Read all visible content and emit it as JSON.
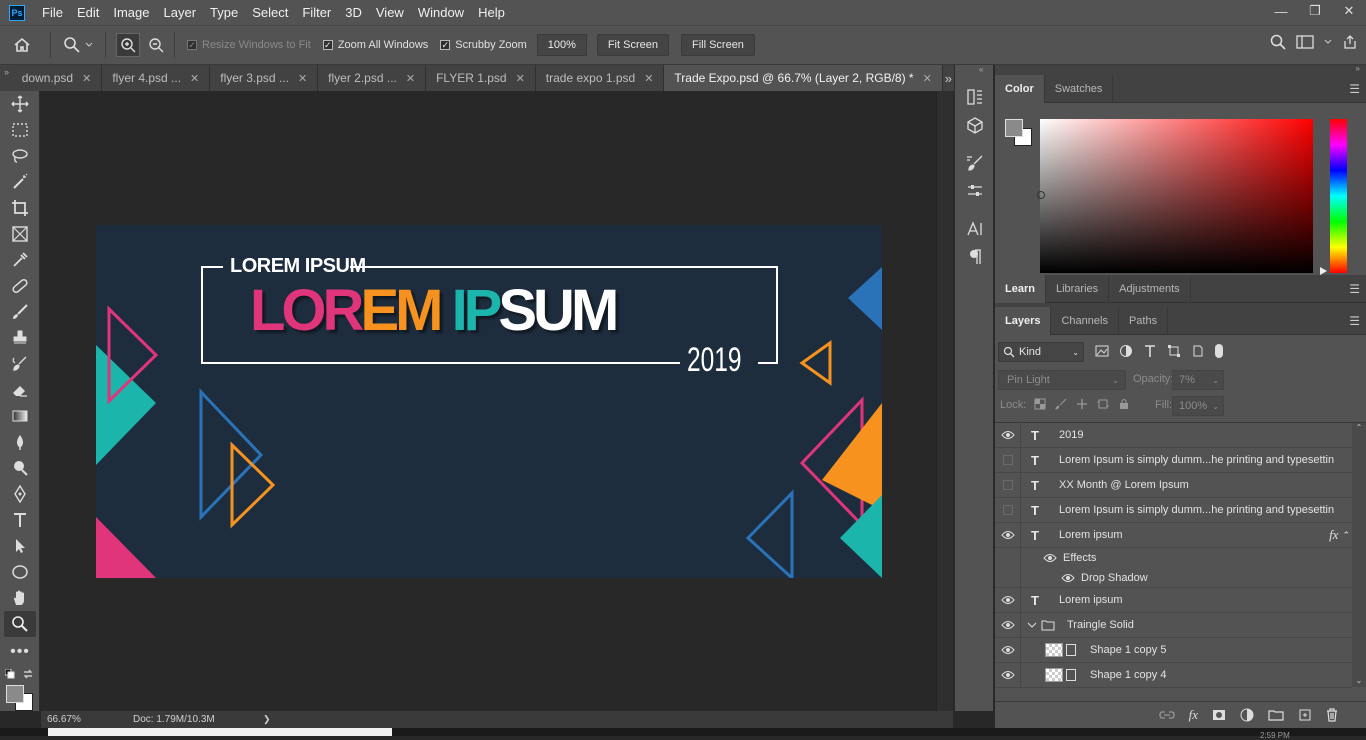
{
  "app": {
    "logo": "Ps"
  },
  "menu": [
    "File",
    "Edit",
    "Image",
    "Layer",
    "Type",
    "Select",
    "Filter",
    "3D",
    "View",
    "Window",
    "Help"
  ],
  "window_controls": {
    "minimize": "—",
    "restore": "❐",
    "close": "✕"
  },
  "options": {
    "resize_windows": "Resize Windows to Fit",
    "zoom_all": "Zoom All Windows",
    "scrubby": "Scrubby Zoom",
    "zoom_value": "100%",
    "fit_screen": "Fit Screen",
    "fill_screen": "Fill Screen"
  },
  "tabs": [
    {
      "label": "down.psd"
    },
    {
      "label": "flyer 4.psd ..."
    },
    {
      "label": "flyer 3.psd ..."
    },
    {
      "label": "flyer 2.psd ..."
    },
    {
      "label": "FLYER 1.psd"
    },
    {
      "label": "trade expo 1.psd"
    },
    {
      "label": "Trade Expo.psd @ 66.7% (Layer 2, RGB/8) *"
    }
  ],
  "tab_close": "✕",
  "tab_overflow": "»",
  "artwork": {
    "top_label": "LOREM IPSUM",
    "headline": {
      "part1": "LOR",
      "part2": "EM",
      "part3": "IP",
      "part4": "SUM"
    },
    "year": "2019",
    "colors": {
      "bg": "#1e2d3e",
      "pink": "#e0357a",
      "orange": "#f7921e",
      "teal": "#1cb5ac",
      "blue": "#2a73b8"
    }
  },
  "status": {
    "zoom": "66.67%",
    "doc": "Doc: 1.79M/10.3M",
    "arrow": "❯"
  },
  "panel_icons": [
    "history-icon",
    "3d-icon",
    "brush-settings-icon",
    "adjust-icon",
    "character-icon",
    "paragraph-icon"
  ],
  "color_panel": {
    "tabs": [
      "Color",
      "Swatches"
    ]
  },
  "learn_panel": {
    "tabs": [
      "Learn",
      "Libraries",
      "Adjustments"
    ]
  },
  "layers_panel": {
    "tabs": [
      "Layers",
      "Channels",
      "Paths"
    ],
    "kind": "Kind",
    "blend": "Pin Light",
    "opacity_label": "Opacity:",
    "opacity": "7%",
    "lock_label": "Lock:",
    "fill_label": "Fill:",
    "fill": "100%",
    "rows": [
      {
        "type": "T",
        "name": "2019",
        "visible": true
      },
      {
        "type": "T",
        "name": "Lorem Ipsum is simply dumm...he printing and typesettin",
        "visible": false
      },
      {
        "type": "T",
        "name": "XX Month @ Lorem Ipsum",
        "visible": false
      },
      {
        "type": "T",
        "name": "Lorem Ipsum is simply dumm...he printing and typesettin",
        "visible": false
      },
      {
        "type": "T",
        "name": "Lorem ipsum",
        "visible": true,
        "fx": "fx"
      },
      {
        "type": "effects",
        "name": "Effects"
      },
      {
        "type": "effect",
        "name": "Drop Shadow"
      },
      {
        "type": "T",
        "name": "Lorem ipsum",
        "visible": true
      },
      {
        "type": "group",
        "name": "Traingle Solid",
        "visible": true
      },
      {
        "type": "shape",
        "name": "Shape 1 copy 5",
        "visible": true
      },
      {
        "type": "shape",
        "name": "Shape 1 copy 4",
        "visible": true
      }
    ]
  },
  "taskbar": {
    "time": "2:59 PM"
  }
}
